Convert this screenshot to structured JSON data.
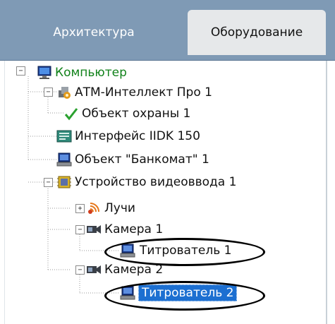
{
  "tabs": {
    "architecture": "Архитектура",
    "equipment": "Оборудование"
  },
  "tree": {
    "computer": "Компьютер",
    "atm_intellect": "АТМ-Интеллект Про 1",
    "security_object": "Объект  охраны 1",
    "iidk_interface": "Интерфейс IIDK 150",
    "atm_object": "Объект \"Банкомат\" 1",
    "video_input": "Устройство видеоввода 1",
    "rays": "Лучи",
    "camera1": "Камера 1",
    "titler1": "Титрователь 1",
    "camera2": "Камера 2",
    "titler2": "Титрователь 2"
  },
  "expanders": {
    "expanded": "−",
    "collapsed": "+"
  },
  "colors": {
    "tabbar": "#7f9ab5",
    "active_tab": "#e6e8ea",
    "selection": "#1c6fd1",
    "computer_label": "#11821a"
  }
}
